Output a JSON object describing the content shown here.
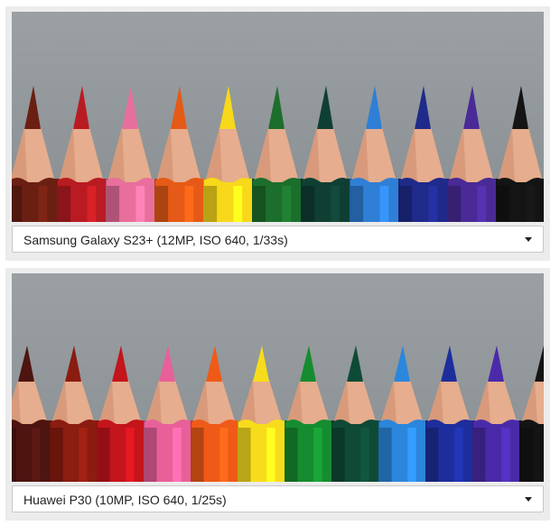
{
  "comparison": [
    {
      "selector": {
        "label": "Samsung Galaxy S23+ (12MP, ISO 640, 1/33s)",
        "caret_icon": "caret-down-icon"
      },
      "pencil_colors": [
        "#6b1f12",
        "#b81c22",
        "#e86f9c",
        "#e55a16",
        "#f7d81a",
        "#1c6e2c",
        "#0f3f33",
        "#2f7fd6",
        "#1f2a8a",
        "#4a2a96",
        "#141414"
      ]
    },
    {
      "selector": {
        "label": "Huawei P30 (10MP, ISO 640, 1/25s)",
        "caret_icon": "caret-down-icon"
      },
      "pencil_colors": [
        "#4e1410",
        "#8a1c10",
        "#c4141c",
        "#e8609a",
        "#ef5a18",
        "#f7dc1c",
        "#168c30",
        "#0e4a35",
        "#2b86dc",
        "#1d2e9c",
        "#4a2aa8",
        "#141414"
      ]
    }
  ]
}
